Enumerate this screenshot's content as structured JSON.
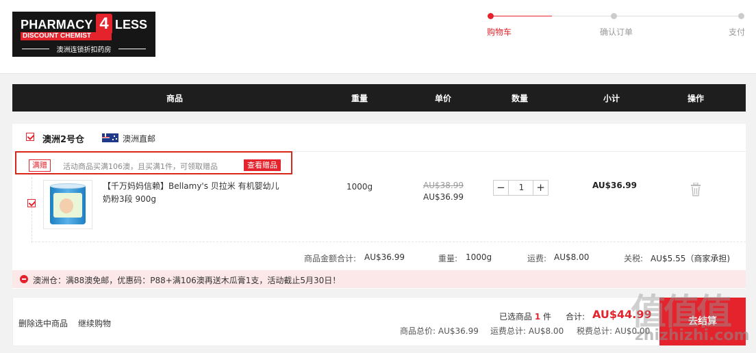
{
  "logo": {
    "brand_left": "PHARMACY",
    "brand_num": "4",
    "brand_right": "LESS",
    "tagline": "DISCOUNT CHEMIST",
    "subtitle": "澳洲连锁折扣药房"
  },
  "steps": [
    {
      "label": "购物车",
      "active": true
    },
    {
      "label": "确认订单",
      "active": false
    },
    {
      "label": "支付",
      "active": false
    }
  ],
  "table_header": {
    "product": "商品",
    "weight": "重量",
    "unit_price": "单价",
    "quantity": "数量",
    "subtotal": "小计",
    "action": "操作"
  },
  "warehouse": {
    "name": "澳洲2号仓",
    "shipping": "澳洲直邮",
    "flag_icon": "australia-flag-icon"
  },
  "promo": {
    "tag": "满赠",
    "text": "活动商品买满106澳，且买满1件，可领取赠品",
    "button": "查看赠品"
  },
  "item": {
    "name": "【千万妈妈信赖】Bellamy's 贝拉米 有机婴幼儿奶粉3段 900g",
    "weight": "1000g",
    "original_price": "AU$38.99",
    "price": "AU$36.99",
    "quantity": "1",
    "subtotal": "AU$36.99",
    "delete_icon": "trash-icon"
  },
  "warehouse_totals": {
    "goods_label": "商品金额合计:",
    "goods_value": "AU$36.99",
    "weight_label": "重量:",
    "weight_value": "1000g",
    "shipping_label": "运费:",
    "shipping_value": "AU$8.00",
    "tax_label": "关税:",
    "tax_value": "AU$5.55（商家承担)"
  },
  "notice": {
    "text": "澳洲仓：满88澳免邮，优惠码：P88+满106澳再送木瓜膏1支，活动截止5月30日！"
  },
  "footer": {
    "delete_selected": "删除选中商品",
    "continue_shopping": "继续购物",
    "selected_prefix": "已选商品",
    "selected_count": "1",
    "selected_suffix": "件",
    "total_label": "合计:",
    "total_value": "AU$44.99",
    "goods_total": "商品总价:  AU$36.99",
    "shipping_total": "运费总计:  AU$8.00",
    "tax_total": "税费总计:  AU$0.00",
    "checkout": "去结算"
  },
  "watermark": {
    "main": "值值值",
    "sub": "zhizhizhi.com"
  },
  "colors": {
    "accent": "#e4232c",
    "header_bar": "#1e1e1e",
    "notice_bg": "#fde8e9"
  }
}
